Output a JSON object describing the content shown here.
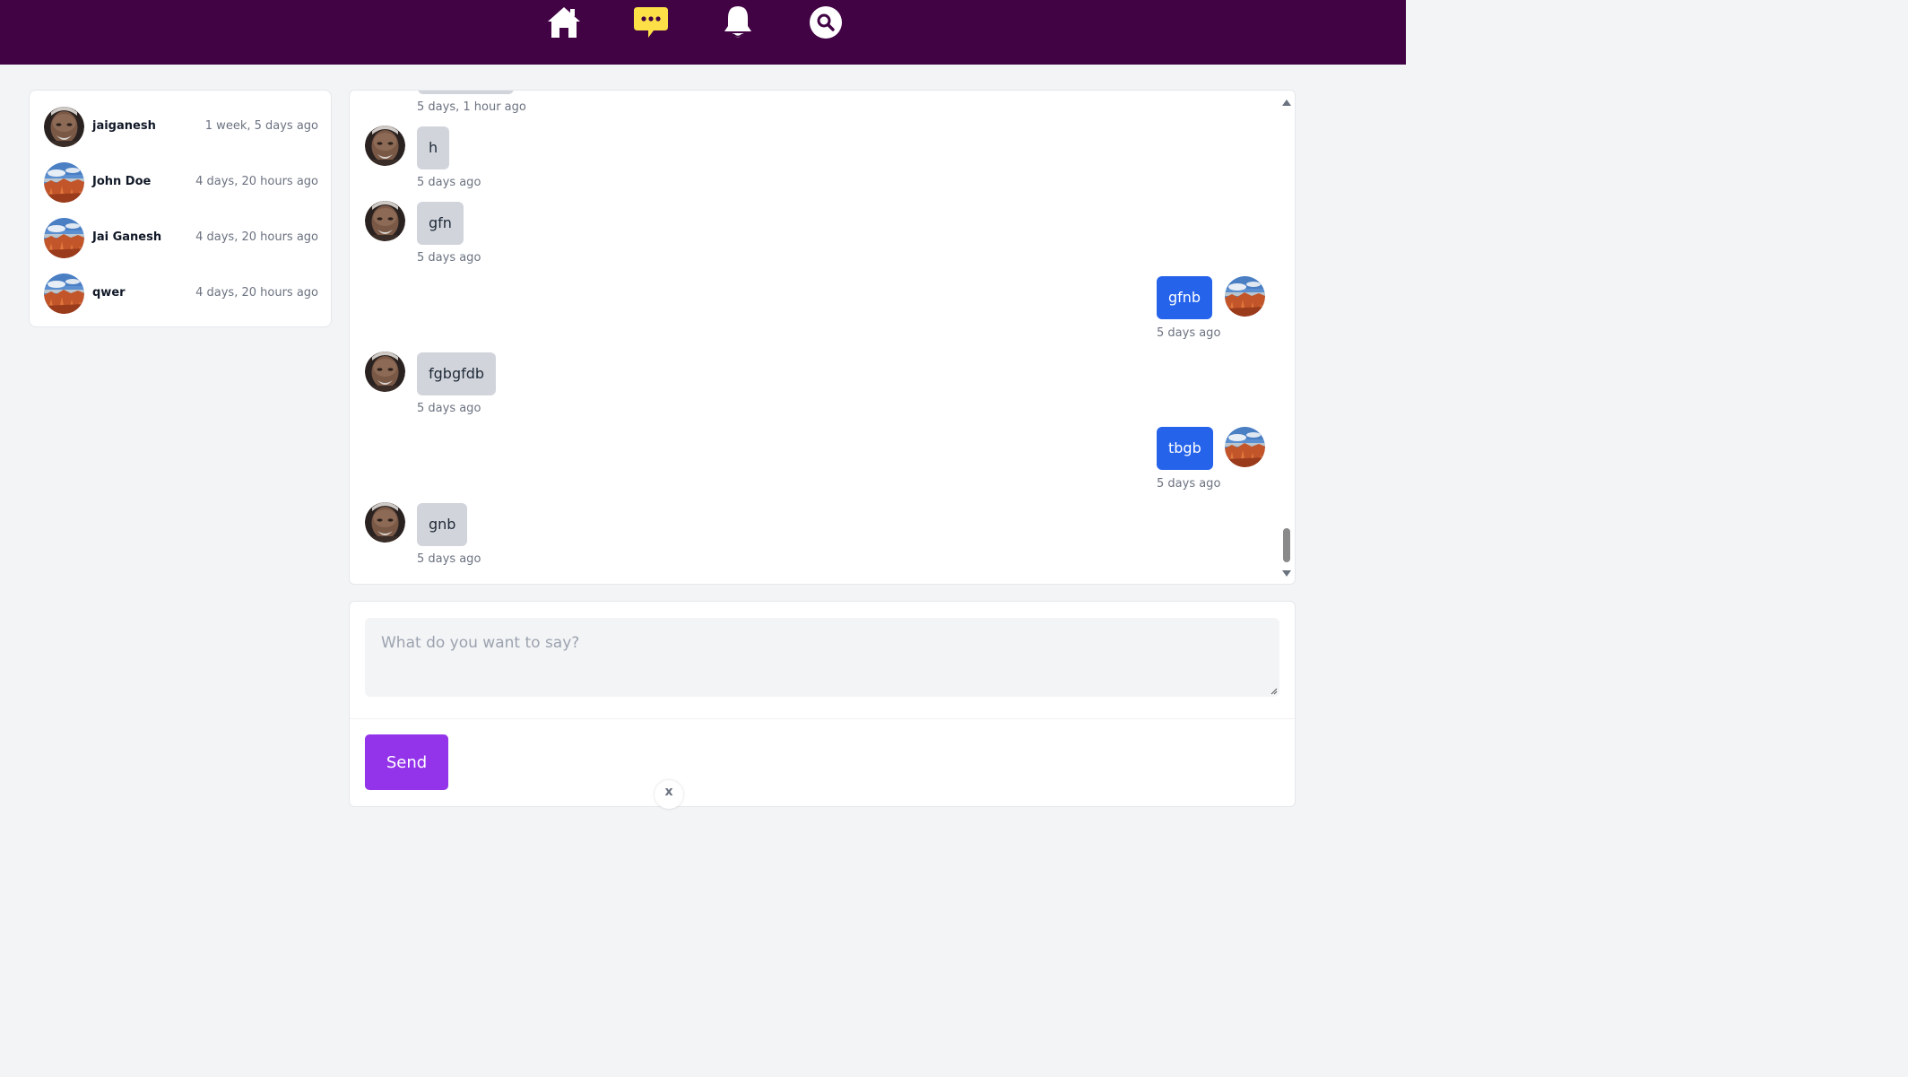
{
  "nav": {
    "items": [
      {
        "icon": "home-icon"
      },
      {
        "icon": "chat-icon",
        "color": "#fde047"
      },
      {
        "icon": "bell-icon"
      },
      {
        "icon": "search-icon"
      }
    ],
    "background": "#420345"
  },
  "conversations": [
    {
      "name": "jaiganesh",
      "time": "1 week, 5 days ago",
      "avatar": "portrait-avatar"
    },
    {
      "name": "John Doe",
      "time": "4 days, 20 hours ago",
      "avatar": "landscape-avatar"
    },
    {
      "name": "Jai Ganesh",
      "time": "4 days, 20 hours ago",
      "avatar": "landscape-avatar"
    },
    {
      "name": "qwer",
      "time": "4 days, 20 hours ago",
      "avatar": "landscape-avatar"
    }
  ],
  "messages": [
    {
      "direction": "in",
      "text": "",
      "time": "5 days, 1 hour ago"
    },
    {
      "direction": "in",
      "text": "h",
      "time": "5 days ago"
    },
    {
      "direction": "in",
      "text": "gfn",
      "time": "5 days ago"
    },
    {
      "direction": "out",
      "text": "gfnb",
      "time": "5 days ago"
    },
    {
      "direction": "in",
      "text": "fgbgfdb",
      "time": "5 days ago"
    },
    {
      "direction": "out",
      "text": "tbgb",
      "time": "5 days ago"
    },
    {
      "direction": "in",
      "text": "gnb",
      "time": "5 days ago"
    }
  ],
  "colors": {
    "incoming_bubble": "#d1d5db",
    "outgoing_bubble": "#2563eb",
    "send_button": "#9333ea"
  },
  "compose": {
    "placeholder": "What do you want to say?",
    "value": "",
    "send_label": "Send"
  },
  "close_chip": {
    "label": "x"
  }
}
